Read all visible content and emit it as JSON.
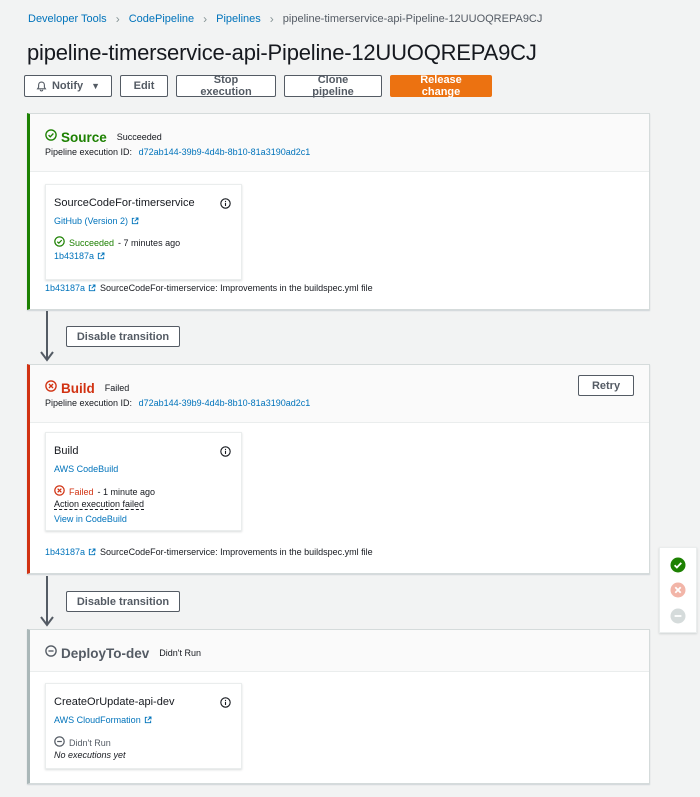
{
  "breadcrumb": {
    "items": [
      "Developer Tools",
      "CodePipeline",
      "Pipelines"
    ],
    "current": "pipeline-timerservice-api-Pipeline-12UUOQREPA9CJ"
  },
  "page_title": "pipeline-timerservice-api-Pipeline-12UUOQREPA9CJ",
  "toolbar": {
    "notify": "Notify",
    "edit": "Edit",
    "stop": "Stop execution",
    "clone": "Clone pipeline",
    "release": "Release change"
  },
  "colors": {
    "success": "#1d8102",
    "error": "#d13212",
    "disabled": "#aab7b8",
    "link": "#0073bb",
    "primary": "#ec7211"
  },
  "stages": {
    "source": {
      "name": "Source",
      "status": "Succeeded",
      "exec_label": "Pipeline execution ID:",
      "exec_id": "d72ab144-39b9-4d4b-8b10-81a3190ad2c1",
      "action": {
        "name": "SourceCodeFor-timerservice",
        "provider": "GitHub (Version 2)",
        "status": "Succeeded",
        "time": "- 7 minutes ago",
        "revision": "1b43187a"
      },
      "commit": {
        "id": "1b43187a",
        "message": "SourceCodeFor-timerservice: Improvements in the buildspec.yml file"
      }
    },
    "build": {
      "name": "Build",
      "status": "Failed",
      "retry": "Retry",
      "exec_label": "Pipeline execution ID:",
      "exec_id": "d72ab144-39b9-4d4b-8b10-81a3190ad2c1",
      "action": {
        "name": "Build",
        "provider": "AWS CodeBuild",
        "status": "Failed",
        "time": "- 1 minute ago",
        "detail": "Action execution failed",
        "view_link": "View in CodeBuild"
      },
      "commit": {
        "id": "1b43187a",
        "message": "SourceCodeFor-timerservice: Improvements in the buildspec.yml file"
      }
    },
    "deploy": {
      "name": "DeployTo-dev",
      "status": "Didn't Run",
      "action": {
        "name": "CreateOrUpdate-api-dev",
        "provider": "AWS CloudFormation",
        "status": "Didn't Run",
        "note": "No executions yet"
      }
    }
  },
  "transitions": {
    "first": "Disable transition",
    "second": "Disable transition"
  },
  "icons": {
    "success": "check-circle-icon",
    "error": "x-circle-icon",
    "disabled": "minus-circle-icon",
    "info": "info-icon",
    "external": "external-link-icon"
  }
}
